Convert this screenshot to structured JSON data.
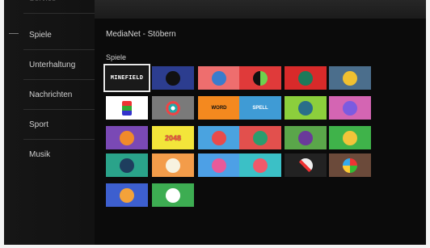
{
  "sidebar": {
    "items": [
      {
        "label": "Service"
      },
      {
        "label": "Spiele"
      },
      {
        "label": "Unterhaltung"
      },
      {
        "label": "Nachrichten"
      },
      {
        "label": "Sport"
      },
      {
        "label": "Musik"
      }
    ]
  },
  "header": {
    "title": "MediaNet - Stöbern"
  },
  "section": {
    "title": "Spiele"
  },
  "tiles": {
    "t0": {
      "bg": "#1a1a1a",
      "text": "MINEFIELD"
    },
    "t1": {
      "bg": "#2c3d8f",
      "icon": "space-game-icon"
    },
    "t2": {
      "bg": "#ee6e6e",
      "icon": "game-logo-icon"
    },
    "t3": {
      "bg": "#e03a3a",
      "icon": "moon-icon"
    },
    "t4": {
      "bg": "#d82a2a",
      "icon": "game-logo-icon"
    },
    "t5": {
      "bg": "#4b6e8c",
      "icon": "game-logo-icon"
    },
    "t6": {
      "bg": "#ffffff",
      "icon": "puzzle-blocks-icon"
    },
    "t7": {
      "bg": "#7a7a7a",
      "icon": "target-icon"
    },
    "t8": {
      "bg": "#f4891f",
      "text": "WORD"
    },
    "t9": {
      "bg": "#3f9bd5",
      "text": "SPELL"
    },
    "t10": {
      "bg": "#8ccf3c",
      "icon": "game-logo-icon"
    },
    "t11": {
      "bg": "#d465b3",
      "icon": "game-logo-icon"
    },
    "t12": {
      "bg": "#7a49b5",
      "icon": "game-logo-icon"
    },
    "t13": {
      "bg": "#f3e53a",
      "text": "2048"
    },
    "t14": {
      "bg": "#4aa3e0",
      "icon": "game-logo-icon"
    },
    "t15": {
      "bg": "#e2504d",
      "icon": "game-logo-icon"
    },
    "t16": {
      "bg": "#5aa64a",
      "icon": "game-logo-icon"
    },
    "t17": {
      "bg": "#3fb34a",
      "icon": "game-logo-icon"
    },
    "t18": {
      "bg": "#2aa38a",
      "icon": "game-logo-icon"
    },
    "t19": {
      "bg": "#f39c4a",
      "icon": "game-logo-icon"
    },
    "t20": {
      "bg": "#4da0e6",
      "icon": "game-logo-icon"
    },
    "t21": {
      "bg": "#3bc0c6",
      "icon": "game-logo-icon"
    },
    "t22": {
      "bg": "#222222",
      "icon": "tools-icon"
    },
    "t23": {
      "bg": "#6b4a3a",
      "icon": "colors-icon"
    },
    "t24": {
      "bg": "#3d5fcf",
      "icon": "game-logo-icon"
    },
    "t25": {
      "bg": "#3dad52",
      "icon": "game-logo-icon"
    }
  },
  "colors": {
    "accent": "#e8e8e8",
    "background": "#0b0b0b"
  }
}
